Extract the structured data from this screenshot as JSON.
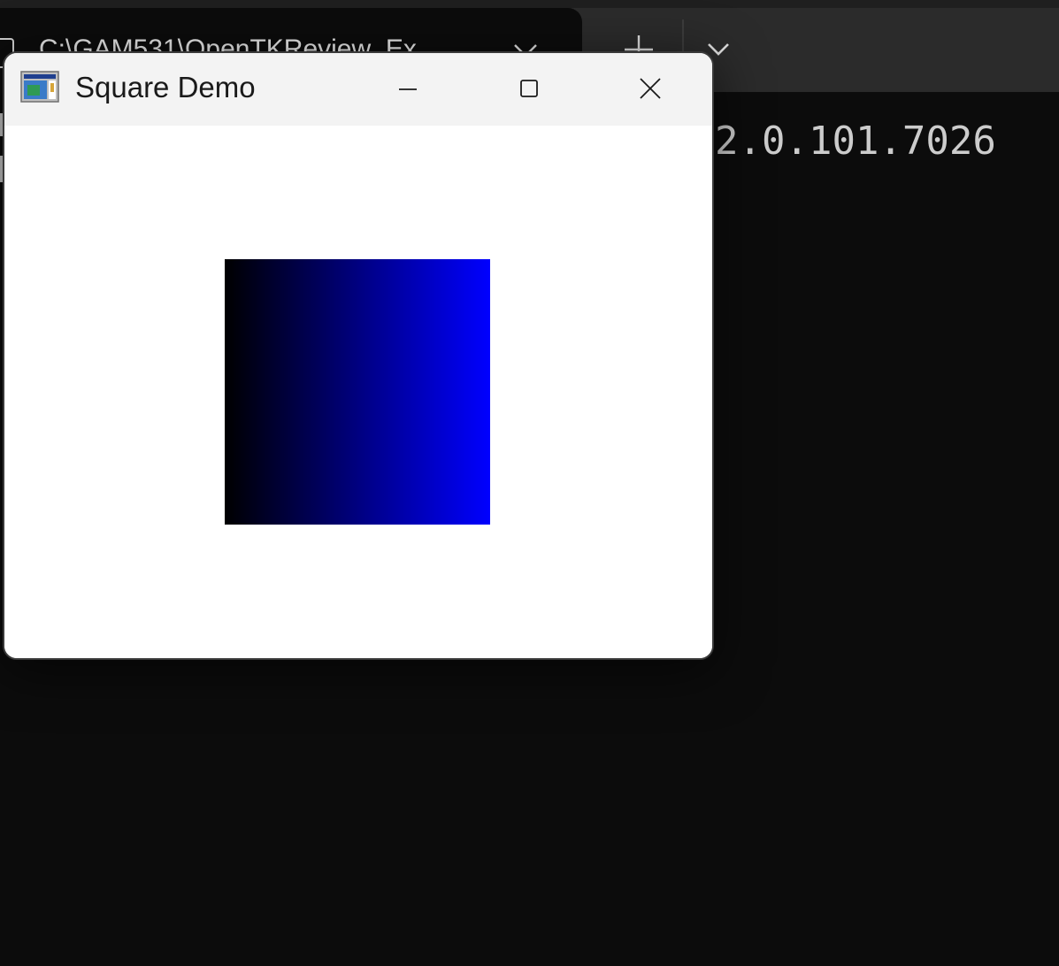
{
  "terminal": {
    "tab_title": "C:\\GAM531\\OpenTKReview_Ex",
    "output_text": "2.0.101.7026",
    "background_color": "#0c0c0c",
    "tab_strip_color": "#2b2b2b",
    "icons": [
      "terminal-tab-icon",
      "close-icon",
      "plus-icon",
      "chevron-down-icon"
    ]
  },
  "window": {
    "title": "Square Demo",
    "icons": [
      "app-icon",
      "minimize-icon",
      "maximize-icon",
      "close-icon"
    ],
    "titlebar_color": "#f3f3f3",
    "client_color": "#ffffff",
    "square": {
      "gradient_start_color": "#000000",
      "gradient_end_color": "#0000ff"
    }
  }
}
